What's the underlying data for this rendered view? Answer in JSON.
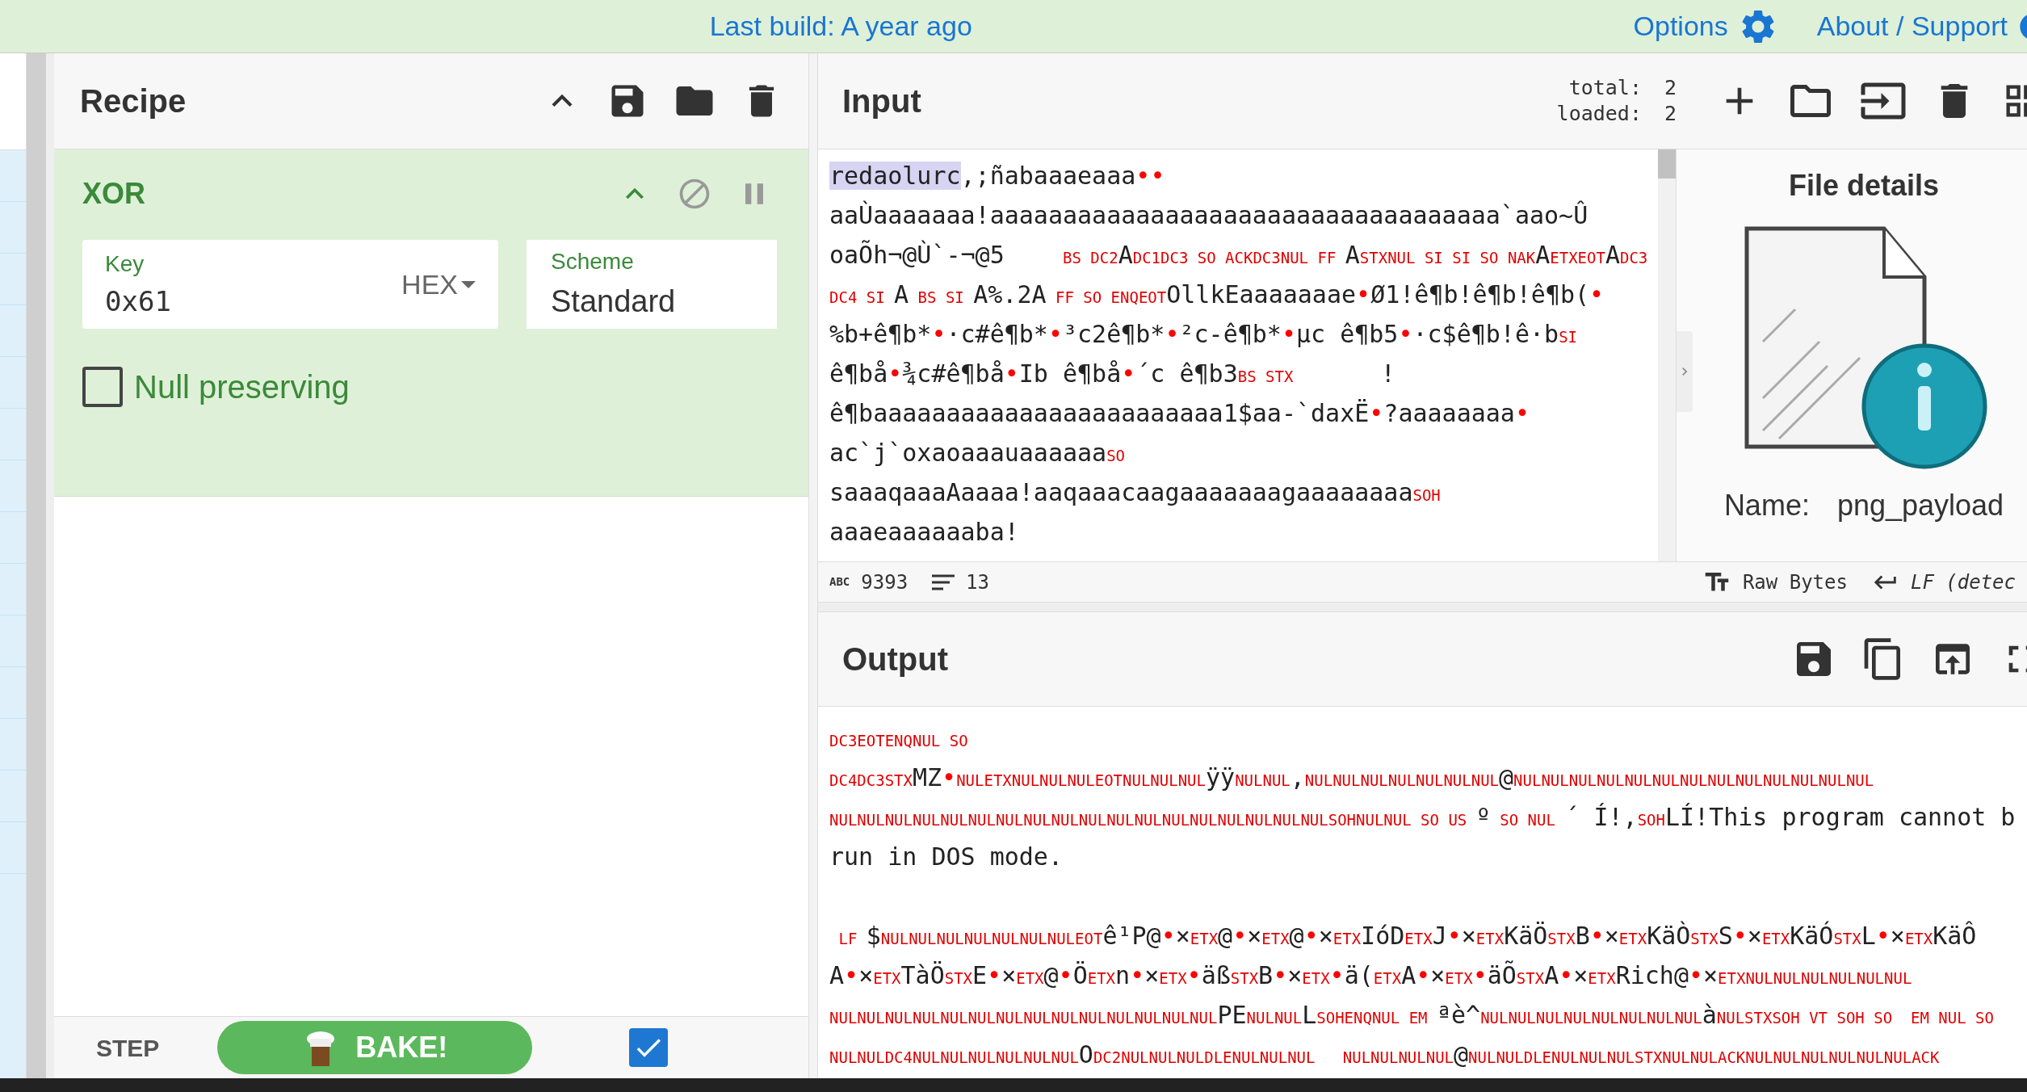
{
  "top_bar": {
    "build": "Last build: A year ago",
    "options": "Options",
    "about": "About / Support"
  },
  "recipe": {
    "title": "Recipe",
    "operation": {
      "name": "XOR",
      "key": {
        "label": "Key",
        "value": "0x61",
        "format": "HEX"
      },
      "scheme": {
        "label": "Scheme",
        "value": "Standard"
      },
      "null_preserving": {
        "label": "Null preserving",
        "checked": false
      }
    }
  },
  "bake": {
    "step": "STEP",
    "bake": "BAKE!",
    "auto_bake": true
  },
  "input": {
    "title": "Input",
    "total_label": "total:",
    "total": "2",
    "loaded_label": "loaded:",
    "loaded": "2",
    "lines": [
      [
        {
          "kind": "highlight",
          "text": "redaolurc"
        },
        {
          "kind": "plain",
          "text": ",;ñabaaaeaaa"
        },
        {
          "kind": "dot",
          "text": "•"
        },
        {
          "kind": "dot",
          "text": "•"
        }
      ],
      [
        {
          "kind": "plain",
          "text": "aaÙaaaaaaa!aaaaaaaaaaaaaaaaaaaaaaaaaaaaaaaaaaa`aao~Û"
        }
      ],
      [
        {
          "kind": "plain",
          "text": "oaÕh¬@Ù`-¬@5    "
        },
        {
          "kind": "ctrl",
          "text": "BS DC2"
        },
        {
          "kind": "plain",
          "text": "A"
        },
        {
          "kind": "ctrl",
          "text": "DC1DC3 SO ACKDC3NUL FF "
        },
        {
          "kind": "plain",
          "text": "A"
        },
        {
          "kind": "ctrl",
          "text": "STXNUL SI SI SO NAK"
        },
        {
          "kind": "plain",
          "text": "A"
        },
        {
          "kind": "ctrl",
          "text": "ETXEOT"
        },
        {
          "kind": "plain",
          "text": "A"
        },
        {
          "kind": "ctrl",
          "text": "DC3"
        }
      ],
      [
        {
          "kind": "ctrl",
          "text": "DC4 SI "
        },
        {
          "kind": "plain",
          "text": "A"
        },
        {
          "kind": "ctrl",
          "text": " BS SI "
        },
        {
          "kind": "plain",
          "text": "A%.2A"
        },
        {
          "kind": "ctrl",
          "text": " FF SO ENQEOT"
        },
        {
          "kind": "plain",
          "text": "OllkEaaaaaaae"
        },
        {
          "kind": "dot",
          "text": "•"
        },
        {
          "kind": "plain",
          "text": "Ø1!ê¶b!ê¶b!ê¶b("
        },
        {
          "kind": "dot",
          "text": "•"
        }
      ],
      [
        {
          "kind": "plain",
          "text": "%b+ê¶b*"
        },
        {
          "kind": "dot",
          "text": "•"
        },
        {
          "kind": "plain",
          "text": "·c#ê¶b*"
        },
        {
          "kind": "dot",
          "text": "•"
        },
        {
          "kind": "plain",
          "text": "³c2ê¶b*"
        },
        {
          "kind": "dot",
          "text": "•"
        },
        {
          "kind": "plain",
          "text": "²c-ê¶b*"
        },
        {
          "kind": "dot",
          "text": "•"
        },
        {
          "kind": "plain",
          "text": "µc ê¶b5"
        },
        {
          "kind": "dot",
          "text": "•"
        },
        {
          "kind": "plain",
          "text": "·c$ê¶b!ê·b"
        },
        {
          "kind": "ctrl",
          "text": "SI"
        }
      ],
      [
        {
          "kind": "plain",
          "text": "ê¶bå"
        },
        {
          "kind": "dot",
          "text": "•"
        },
        {
          "kind": "plain",
          "text": "¾c#ê¶bå"
        },
        {
          "kind": "dot",
          "text": "•"
        },
        {
          "kind": "plain",
          "text": "Ib ê¶bå"
        },
        {
          "kind": "dot",
          "text": "•"
        },
        {
          "kind": "plain",
          "text": "´c ê¶b3"
        },
        {
          "kind": "ctrl",
          "text": "BS STX"
        },
        {
          "kind": "plain",
          "text": "      !"
        }
      ],
      [
        {
          "kind": "plain",
          "text": "ê¶baaaaaaaaaaaaaaaaaaaaaaaa1$aa-`daxË"
        },
        {
          "kind": "dot",
          "text": "•"
        },
        {
          "kind": "plain",
          "text": "?aaaaaaaa"
        },
        {
          "kind": "dot",
          "text": "•"
        }
      ],
      [
        {
          "kind": "plain",
          "text": "ac`j`oxaoaaauaaaaaa"
        },
        {
          "kind": "ctrl",
          "text": "SO"
        }
      ],
      [
        {
          "kind": "plain",
          "text": "saaaqaaaAaaaa!aaqaaacaagaaaaaaagaaaaaaaa"
        },
        {
          "kind": "ctrl",
          "text": "SOH"
        }
      ],
      [
        {
          "kind": "plain",
          "text": "aaaeaaaaaaba!"
        }
      ]
    ],
    "status": {
      "length_label": "ABC",
      "length": "9393",
      "lines": "13",
      "format": "Raw Bytes",
      "eol": "LF (detec"
    }
  },
  "file_details": {
    "title": "File details",
    "name_label": "Name:",
    "name": "png_payload"
  },
  "output": {
    "title": "Output",
    "lines": [
      {
        "kind": "text",
        "segments": [
          {
            "kind": "ctrl",
            "text": "DC3EOTENQNUL SO"
          }
        ]
      },
      {
        "kind": "text",
        "segments": [
          {
            "kind": "ctrl",
            "text": "DC4DC3STX"
          },
          {
            "kind": "plain",
            "text": "MZ"
          },
          {
            "kind": "dot",
            "text": "•"
          },
          {
            "kind": "ctrl",
            "text": "NULETXNULNULNULEOTNULNULNUL"
          },
          {
            "kind": "plain",
            "text": "ÿÿ"
          },
          {
            "kind": "ctrl",
            "text": "NULNUL"
          },
          {
            "kind": "plain",
            "text": ","
          },
          {
            "kind": "ctrl",
            "text": "NULNULNULNULNULNULNUL"
          },
          {
            "kind": "plain",
            "text": "@"
          },
          {
            "kind": "ctrl",
            "text": "NULNULNULNULNULNULNULNULNULNULNULNULNUL"
          }
        ]
      },
      {
        "kind": "text",
        "segments": [
          {
            "kind": "ctrl",
            "text": "NULNULNULNULNULNULNULNULNULNULNULNULNULNULNULNULNULNULSOHNULNUL SO US "
          },
          {
            "kind": "plain",
            "text": "º"
          },
          {
            "kind": "ctrl",
            "text": " SO NUL "
          },
          {
            "kind": "plain",
            "text": "´ Í!,"
          },
          {
            "kind": "ctrl",
            "text": "SOH"
          },
          {
            "kind": "plain",
            "text": "LÍ!This program cannot b"
          }
        ]
      },
      {
        "kind": "text",
        "segments": [
          {
            "kind": "plain",
            "text": "run in DOS mode."
          }
        ]
      },
      {
        "kind": "blank"
      },
      {
        "kind": "text",
        "segments": [
          {
            "kind": "ctrl",
            "text": " LF "
          },
          {
            "kind": "plain",
            "text": "$"
          },
          {
            "kind": "ctrl",
            "text": "NULNULNULNULNULNULNULEOT"
          },
          {
            "kind": "plain",
            "text": "ê¹P@"
          },
          {
            "kind": "dot",
            "text": "•"
          },
          {
            "kind": "plain",
            "text": "×"
          },
          {
            "kind": "ctrl",
            "text": "ETX"
          },
          {
            "kind": "plain",
            "text": "@"
          },
          {
            "kind": "dot",
            "text": "•"
          },
          {
            "kind": "plain",
            "text": "×"
          },
          {
            "kind": "ctrl",
            "text": "ETX"
          },
          {
            "kind": "plain",
            "text": "@"
          },
          {
            "kind": "dot",
            "text": "•"
          },
          {
            "kind": "plain",
            "text": "×"
          },
          {
            "kind": "ctrl",
            "text": "ETX"
          },
          {
            "kind": "plain",
            "text": "IóD"
          },
          {
            "kind": "ctrl",
            "text": "ETX"
          },
          {
            "kind": "plain",
            "text": "J"
          },
          {
            "kind": "dot",
            "text": "•"
          },
          {
            "kind": "plain",
            "text": "×"
          },
          {
            "kind": "ctrl",
            "text": "ETX"
          },
          {
            "kind": "plain",
            "text": "KäÖ"
          },
          {
            "kind": "ctrl",
            "text": "STX"
          },
          {
            "kind": "plain",
            "text": "B"
          },
          {
            "kind": "dot",
            "text": "•"
          },
          {
            "kind": "plain",
            "text": "×"
          },
          {
            "kind": "ctrl",
            "text": "ETX"
          },
          {
            "kind": "plain",
            "text": "KäÒ"
          },
          {
            "kind": "ctrl",
            "text": "STX"
          },
          {
            "kind": "plain",
            "text": "S"
          },
          {
            "kind": "dot",
            "text": "•"
          },
          {
            "kind": "plain",
            "text": "×"
          },
          {
            "kind": "ctrl",
            "text": "ETX"
          },
          {
            "kind": "plain",
            "text": "KäÓ"
          },
          {
            "kind": "ctrl",
            "text": "STX"
          },
          {
            "kind": "plain",
            "text": "L"
          },
          {
            "kind": "dot",
            "text": "•"
          },
          {
            "kind": "plain",
            "text": "×"
          },
          {
            "kind": "ctrl",
            "text": "ETX"
          },
          {
            "kind": "plain",
            "text": "KäÔ"
          }
        ]
      },
      {
        "kind": "text",
        "segments": [
          {
            "kind": "plain",
            "text": "A"
          },
          {
            "kind": "dot",
            "text": "•"
          },
          {
            "kind": "plain",
            "text": "×"
          },
          {
            "kind": "ctrl",
            "text": "ETX"
          },
          {
            "kind": "plain",
            "text": "TàÖ"
          },
          {
            "kind": "ctrl",
            "text": "STX"
          },
          {
            "kind": "plain",
            "text": "E"
          },
          {
            "kind": "dot",
            "text": "•"
          },
          {
            "kind": "plain",
            "text": "×"
          },
          {
            "kind": "ctrl",
            "text": "ETX"
          },
          {
            "kind": "plain",
            "text": "@"
          },
          {
            "kind": "dot",
            "text": "•"
          },
          {
            "kind": "plain",
            "text": "Ö"
          },
          {
            "kind": "ctrl",
            "text": "ETX"
          },
          {
            "kind": "plain",
            "text": "n"
          },
          {
            "kind": "dot",
            "text": "•"
          },
          {
            "kind": "plain",
            "text": "×"
          },
          {
            "kind": "ctrl",
            "text": "ETX"
          },
          {
            "kind": "dot",
            "text": "•"
          },
          {
            "kind": "plain",
            "text": "äß"
          },
          {
            "kind": "ctrl",
            "text": "STX"
          },
          {
            "kind": "plain",
            "text": "B"
          },
          {
            "kind": "dot",
            "text": "•"
          },
          {
            "kind": "plain",
            "text": "×"
          },
          {
            "kind": "ctrl",
            "text": "ETX"
          },
          {
            "kind": "dot",
            "text": "•"
          },
          {
            "kind": "plain",
            "text": "ä("
          },
          {
            "kind": "ctrl",
            "text": "ETX"
          },
          {
            "kind": "plain",
            "text": "A"
          },
          {
            "kind": "dot",
            "text": "•"
          },
          {
            "kind": "plain",
            "text": "×"
          },
          {
            "kind": "ctrl",
            "text": "ETX"
          },
          {
            "kind": "dot",
            "text": "•"
          },
          {
            "kind": "plain",
            "text": "äÕ"
          },
          {
            "kind": "ctrl",
            "text": "STX"
          },
          {
            "kind": "plain",
            "text": "A"
          },
          {
            "kind": "dot",
            "text": "•"
          },
          {
            "kind": "plain",
            "text": "×"
          },
          {
            "kind": "ctrl",
            "text": "ETX"
          },
          {
            "kind": "plain",
            "text": "Rich@"
          },
          {
            "kind": "dot",
            "text": "•"
          },
          {
            "kind": "plain",
            "text": "×"
          },
          {
            "kind": "ctrl",
            "text": "ETXNULNULNULNULNULNUL"
          }
        ]
      },
      {
        "kind": "text",
        "segments": [
          {
            "kind": "ctrl",
            "text": "NULNULNULNULNULNULNULNULNULNULNULNULNULNUL"
          },
          {
            "kind": "plain",
            "text": "PE"
          },
          {
            "kind": "ctrl",
            "text": "NULNUL"
          },
          {
            "kind": "plain",
            "text": "L"
          },
          {
            "kind": "ctrl",
            "text": "SOHENQNUL EM "
          },
          {
            "kind": "plain",
            "text": "ªè^"
          },
          {
            "kind": "ctrl",
            "text": "NULNULNULNULNULNULNULNUL"
          },
          {
            "kind": "plain",
            "text": "à"
          },
          {
            "kind": "ctrl",
            "text": "NULSTXSOH VT SOH SO  EM NUL SO"
          }
        ]
      },
      {
        "kind": "text",
        "segments": [
          {
            "kind": "ctrl",
            "text": "NULNULDC4NULNULNULNULNULNUL"
          },
          {
            "kind": "plain",
            "text": "O"
          },
          {
            "kind": "ctrl",
            "text": "DC2NULNULNULDLENULNULNUL   NULNULNULNUL"
          },
          {
            "kind": "plain",
            "text": "@"
          },
          {
            "kind": "ctrl",
            "text": "NULNULDLENULNULNULSTXNULNULACKNULNULNULNULNULNULACK"
          }
        ]
      }
    ]
  }
}
